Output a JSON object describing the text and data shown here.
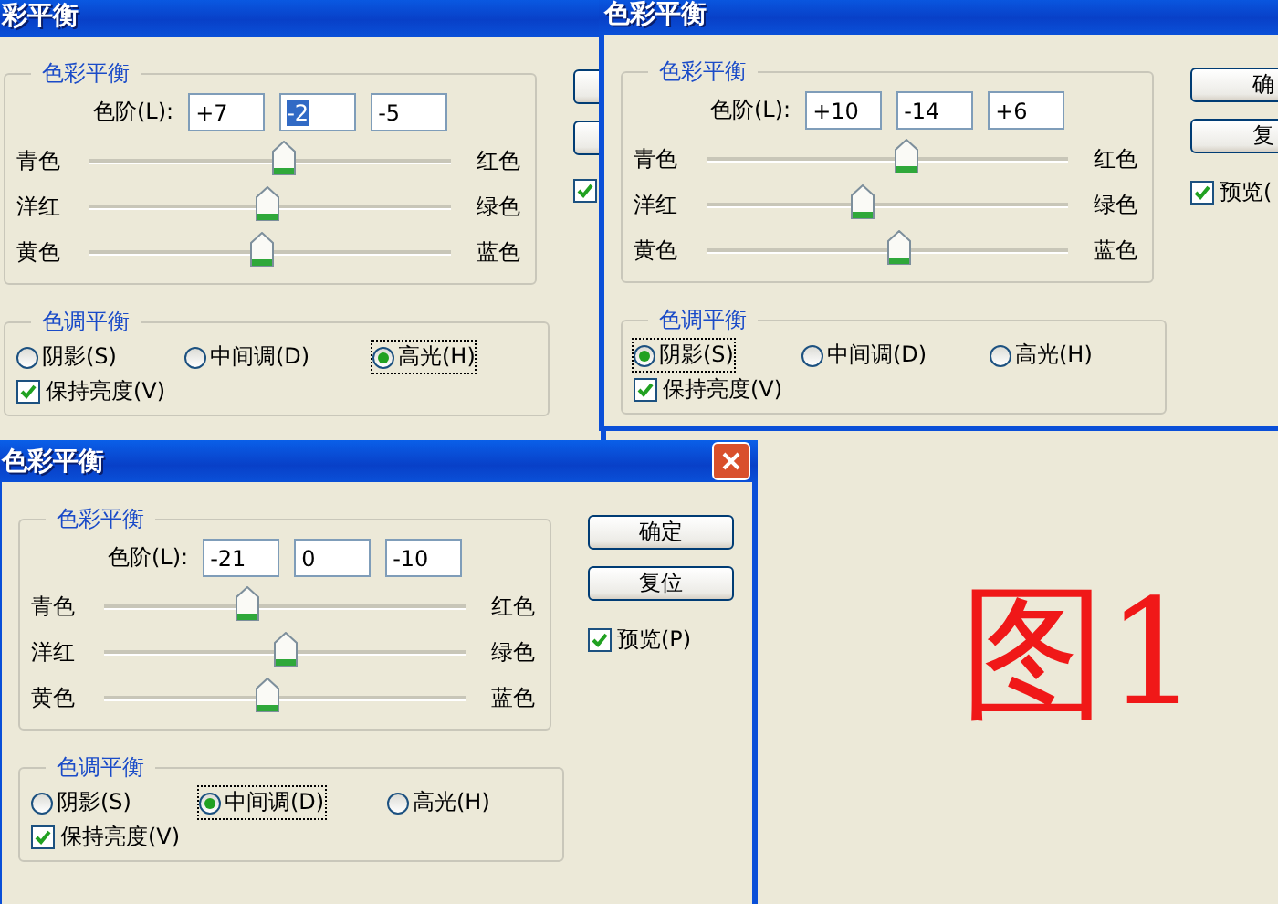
{
  "windows": [
    {
      "title": "彩平衡",
      "close_button": false,
      "color_group": {
        "title": "色彩平衡",
        "levels_label": "色阶(L):",
        "levels": [
          {
            "value": "+7",
            "selected": false
          },
          {
            "value": "-2",
            "selected": true
          },
          {
            "value": "-5",
            "selected": false
          }
        ],
        "sliders": [
          {
            "left": "青色",
            "right": "红色",
            "level": 0.535
          },
          {
            "left": "洋红",
            "right": "绿色",
            "level": 0.49
          },
          {
            "left": "黄色",
            "right": "蓝色",
            "level": 0.475
          }
        ]
      },
      "tone_group": {
        "title": "色调平衡",
        "options": [
          {
            "label": "阴影(S)",
            "selected": false
          },
          {
            "label": "中间调(D)",
            "selected": false
          },
          {
            "label": "高光(H)",
            "selected": true
          }
        ],
        "preserve": {
          "label": "保持亮度(V)",
          "checked": true
        }
      },
      "buttons": [
        {
          "kind": "covered"
        },
        {
          "kind": "covered"
        }
      ],
      "preview": {
        "checked": true
      }
    },
    {
      "title": "色彩平衡",
      "close_button": false,
      "color_group": {
        "title": "色彩平衡",
        "levels_label": "色阶(L):",
        "levels": [
          {
            "value": "+10",
            "selected": false
          },
          {
            "value": "-14",
            "selected": false
          },
          {
            "value": "+6",
            "selected": false
          }
        ],
        "sliders": [
          {
            "left": "青色",
            "right": "红色",
            "level": 0.55
          },
          {
            "left": "洋红",
            "right": "绿色",
            "level": 0.43
          },
          {
            "left": "黄色",
            "right": "蓝色",
            "level": 0.53
          }
        ]
      },
      "tone_group": {
        "title": "色调平衡",
        "options": [
          {
            "label": "阴影(S)",
            "selected": true
          },
          {
            "label": "中间调(D)",
            "selected": false
          },
          {
            "label": "高光(H)",
            "selected": false
          }
        ],
        "preserve": {
          "label": "保持亮度(V)",
          "checked": true
        }
      },
      "buttons": [
        {
          "kind": "labeled",
          "label": "确"
        },
        {
          "kind": "labeled",
          "label": "复"
        }
      ],
      "preview": {
        "checked": true,
        "label": "预览("
      }
    },
    {
      "title": "色彩平衡",
      "close_button": true,
      "color_group": {
        "title": "色彩平衡",
        "levels_label": "色阶(L):",
        "levels": [
          {
            "value": "-21",
            "selected": false
          },
          {
            "value": "0",
            "selected": false
          },
          {
            "value": "-10",
            "selected": false
          }
        ],
        "sliders": [
          {
            "left": "青色",
            "right": "红色",
            "level": 0.395
          },
          {
            "left": "洋红",
            "right": "绿色",
            "level": 0.5
          },
          {
            "left": "黄色",
            "right": "蓝色",
            "level": 0.45
          }
        ]
      },
      "tone_group": {
        "title": "色调平衡",
        "options": [
          {
            "label": "阴影(S)",
            "selected": false
          },
          {
            "label": "中间调(D)",
            "selected": true
          },
          {
            "label": "高光(H)",
            "selected": false
          }
        ],
        "preserve": {
          "label": "保持亮度(V)",
          "checked": true
        }
      },
      "buttons": [
        {
          "kind": "labeled",
          "label": "确定"
        },
        {
          "kind": "labeled",
          "label": "复位"
        }
      ],
      "preview": {
        "checked": true,
        "label": "预览(P)"
      }
    }
  ],
  "figure_label": "图1"
}
